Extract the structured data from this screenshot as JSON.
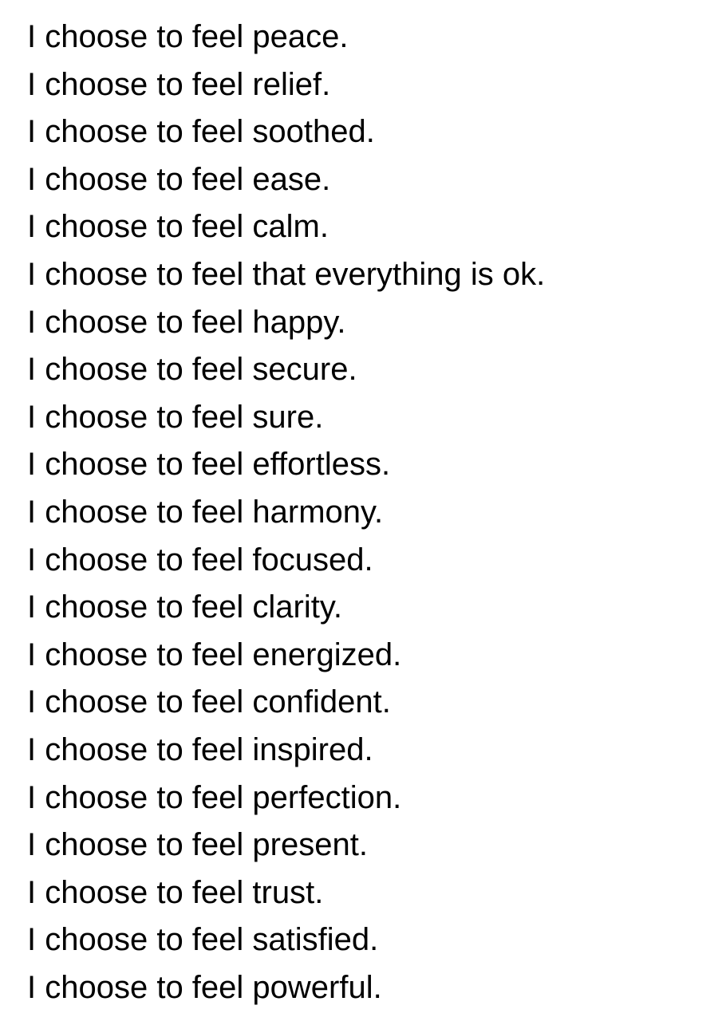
{
  "note": {
    "lines": [
      "I choose to feel peace.",
      "I choose to feel relief.",
      "I choose to feel soothed.",
      "I choose to feel ease.",
      "I choose to feel calm.",
      "I choose to feel that everything is ok.",
      "I choose to feel happy.",
      "I choose to feel secure.",
      "I choose to feel sure.",
      "I choose to feel effortless.",
      "I choose to feel harmony.",
      "I choose to feel focused.",
      "I choose to feel clarity.",
      "I choose to feel energized.",
      "I choose to feel confident.",
      "I choose to feel inspired.",
      "I choose to feel perfection.",
      "I choose to feel present.",
      "I choose to feel trust.",
      "I choose to feel satisfied.",
      "I choose to feel powerful."
    ]
  },
  "colors": {
    "background": "#ffffff",
    "text": "#000000"
  }
}
